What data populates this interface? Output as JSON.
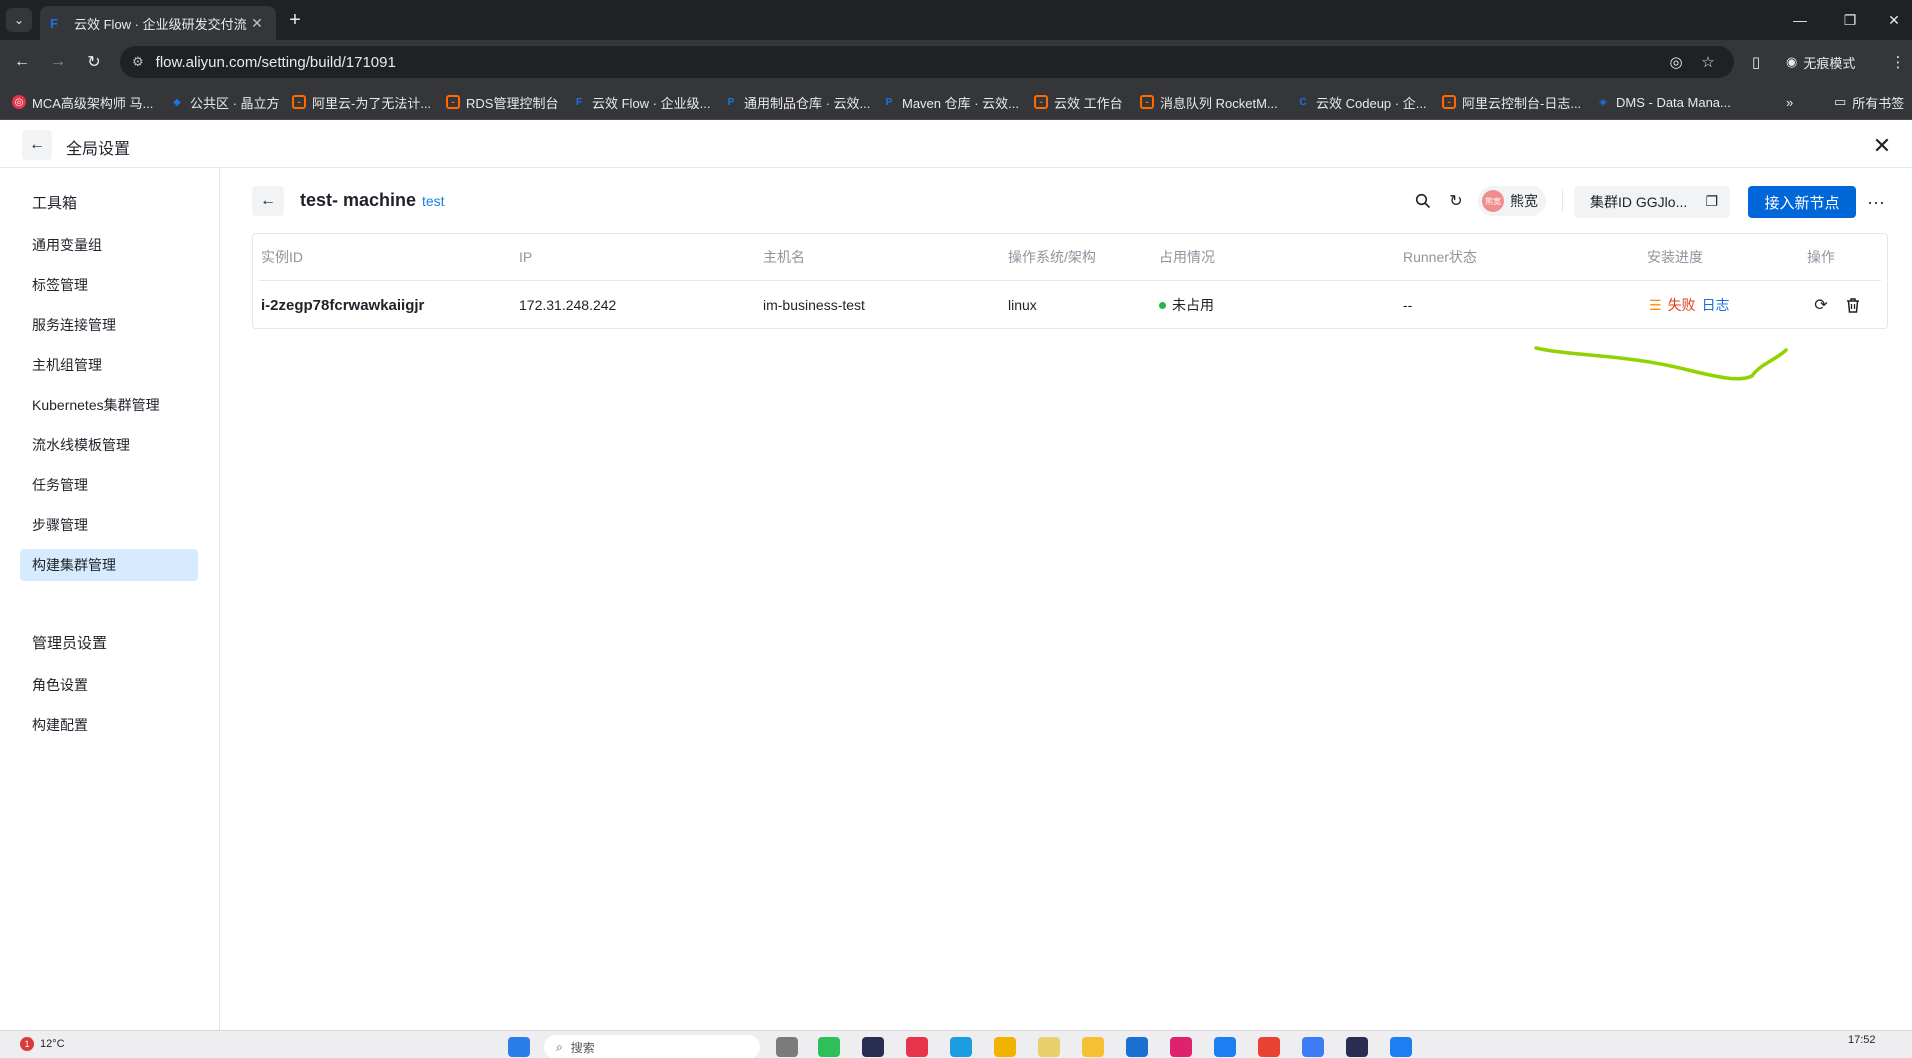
{
  "browser": {
    "tab_title": "云效 Flow · 企业级研发交付流",
    "tab_favicon": "F",
    "url": "flow.aliyun.com/setting/build/171091",
    "incognito_label": "无痕模式",
    "bookmarks": [
      {
        "label": "MCA高级架构师 马...",
        "icon": "red"
      },
      {
        "label": "公共区 · 晶立方",
        "icon": "blue"
      },
      {
        "label": "阿里云-为了无法计...",
        "icon": "orange"
      },
      {
        "label": "RDS管理控制台",
        "icon": "orange"
      },
      {
        "label": "云效 Flow · 企业级...",
        "icon": "blue"
      },
      {
        "label": "通用制品仓库 · 云效...",
        "icon": "blue"
      },
      {
        "label": "Maven 仓库 · 云效...",
        "icon": "blue"
      },
      {
        "label": "云效 工作台",
        "icon": "orange"
      },
      {
        "label": "消息队列 RocketM...",
        "icon": "orange"
      },
      {
        "label": "云效 Codeup · 企...",
        "icon": "blue"
      },
      {
        "label": "阿里云控制台-日志...",
        "icon": "orange"
      },
      {
        "label": "DMS - Data Mana...",
        "icon": "blue"
      }
    ],
    "all_bookmarks_label": "所有书签"
  },
  "header": {
    "title": "全局设置"
  },
  "sidebar": {
    "groups": [
      {
        "label": "工具箱",
        "items": [
          "通用变量组",
          "标签管理",
          "服务连接管理",
          "主机组管理",
          "Kubernetes集群管理",
          "流水线模板管理",
          "任务管理",
          "步骤管理",
          "构建集群管理"
        ]
      },
      {
        "label": "管理员设置",
        "items": [
          "角色设置",
          "构建配置"
        ]
      }
    ],
    "active_item": "构建集群管理"
  },
  "main": {
    "title": "test- machine",
    "tag": "test",
    "owner_name": "熊宽",
    "owner_avatar_text": "熊宽",
    "cluster_id_label": "集群ID GGJlo...",
    "add_node_label": "接入新节点",
    "table": {
      "columns": [
        "实例ID",
        "IP",
        "主机名",
        "操作系统/架构",
        "占用情况",
        "Runner状态",
        "安装进度",
        "操作"
      ],
      "rows": [
        {
          "instance_id": "i-2zegp78fcrwawkaiigjr",
          "ip": "172.31.248.242",
          "hostname": "im-business-test",
          "os": "linux",
          "occupancy": "未占用",
          "runner_status": "--",
          "install_status": "失败",
          "log_link": "日志"
        }
      ]
    },
    "annotation_color": "#8fd400"
  },
  "taskbar": {
    "weather": "12°C",
    "weather_badge": "1",
    "search_placeholder": "搜索",
    "time": "17:52"
  }
}
